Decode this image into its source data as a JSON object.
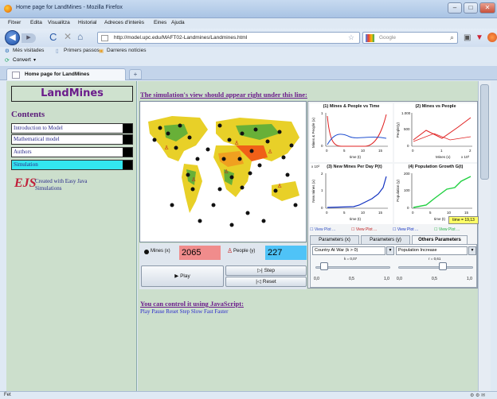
{
  "window": {
    "title": "Home page for LandMines - Mozilla Firefox"
  },
  "menu": [
    "Fitxer",
    "Edita",
    "Visualitza",
    "Historial",
    "Adreces d'interès",
    "Eines",
    "Ajuda"
  ],
  "nav": {
    "url": "http://model.upc.edu/MAFT02-Landmines/Landmines.html",
    "search_placeholder": "Google"
  },
  "bookmarks": [
    "Més visitades",
    "Primers passos",
    "Darreres notícies"
  ],
  "convert": "Convert",
  "tab": {
    "label": "Home page for LandMines",
    "new_tab": "+"
  },
  "left": {
    "title": "LandMines",
    "contents_heading": "Contents",
    "items": [
      {
        "label": "Introduction to Model",
        "selected": false
      },
      {
        "label": "Mathematical model",
        "selected": false
      },
      {
        "label": "Authors",
        "selected": false
      },
      {
        "label": "Simulation",
        "selected": true
      }
    ],
    "ejs_logo": "EJS",
    "ejs_text": "Created with Easy Java Simulations"
  },
  "main": {
    "sim_heading": "The simulation's view should appear right under this line:",
    "js_heading": "You can control it using JavaScript:",
    "js_links": [
      "Play",
      "Pause",
      "Reset",
      "Step",
      "Slow",
      "Fast",
      "Faster"
    ]
  },
  "sim": {
    "mines_label": "Mines (x)",
    "mines_value": "2065",
    "people_label": "People (y)",
    "people_value": "227",
    "play_label": "Play",
    "step_label": "Step",
    "reset_label": "Reset",
    "plots": [
      {
        "title": "(1) Mines & People vs Time",
        "ylabel": "Mines & People (x)",
        "xlabel": "time (t)",
        "yticks": [
          "1",
          "0"
        ],
        "xticks": [
          "0",
          "5",
          "10",
          "15"
        ]
      },
      {
        "title": "(2) Mines vs People",
        "ylabel": "People(y)",
        "xlabel": "Mines (x)",
        "yticks": [
          "1.000",
          "500",
          "0"
        ],
        "xticks": [
          "0",
          "1",
          "2"
        ],
        "xunit": "x 10³"
      },
      {
        "title": "(3) New Mines Per Day P(t)",
        "ylabel": "New mines (x)",
        "xlabel": "time (t)",
        "yticks": [
          "2",
          "1",
          "0"
        ],
        "xticks": [
          "0",
          "5",
          "10",
          "15"
        ],
        "yunit": "x 10³"
      },
      {
        "title": "(4) Population Growth G(t)",
        "ylabel": "Population (y)",
        "xlabel": "time (t)",
        "yticks": [
          "200",
          "100",
          "0"
        ],
        "xticks": [
          "0",
          "5",
          "10",
          "15"
        ]
      }
    ],
    "time_label": "time = 19,13",
    "view_plot_checks": [
      "View Plot ...",
      "View Plot ...",
      "View Plot ...",
      "View Plot ..."
    ],
    "param_tabs": [
      "Parameters (x)",
      "Parameters (y)",
      "Others Parameters"
    ],
    "dropdowns": [
      {
        "label": "Country At War (k > 0)",
        "slider_label": "k = 0,07",
        "ticks": [
          "0,0",
          "0,5",
          "1,0"
        ],
        "fraction": 0.07
      },
      {
        "label": "Population Increase",
        "slider_label": "r = 0,61",
        "ticks": [
          "0,0",
          "0,5",
          "1,0"
        ],
        "fraction": 0.61
      }
    ],
    "colors": {
      "mines_field": "#f08c8c",
      "people_field": "#4fc3f7",
      "time_badge": "#ffff66",
      "heading": "#6b1c8b",
      "plot1_red": "#e02020",
      "plot1_blue": "#2050d0",
      "plot2_red": "#e02020",
      "plot3_blue": "#1030c0",
      "plot4_green": "#20d040"
    }
  },
  "status": "Fet"
}
